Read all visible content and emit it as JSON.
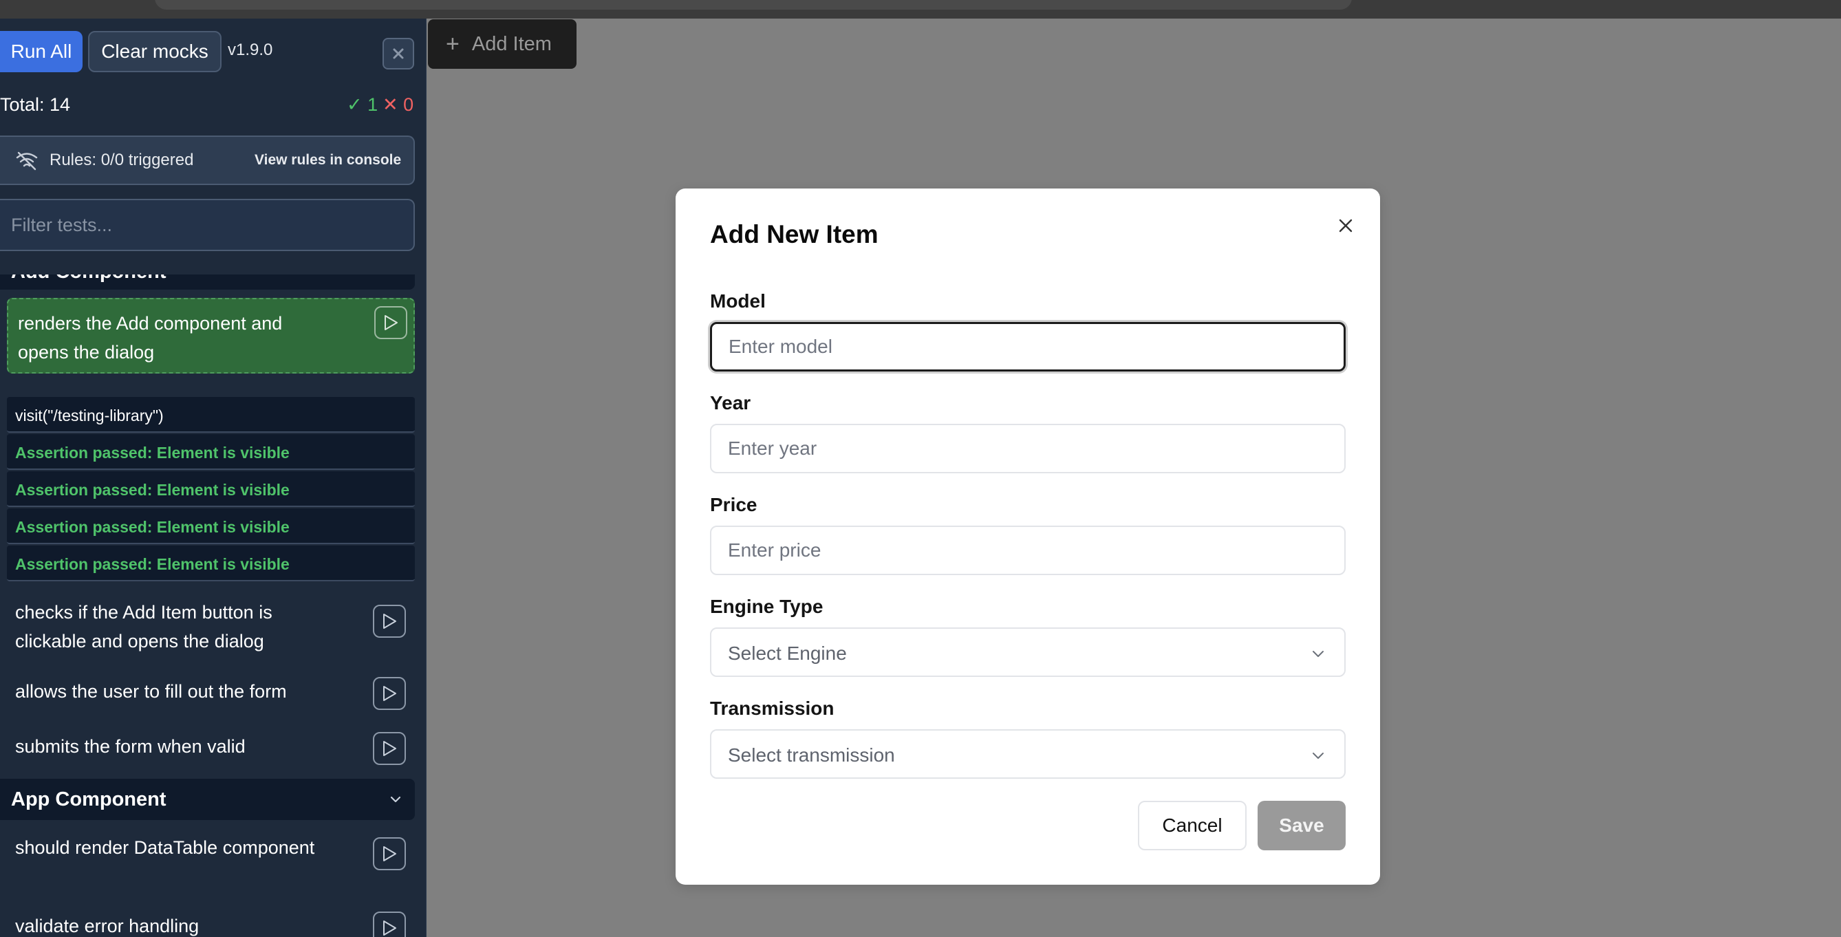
{
  "toolbar": {
    "run_all": "Run All",
    "clear_mocks": "Clear mocks",
    "version": "v1.9.0"
  },
  "totals": {
    "label": "Total: 14",
    "passed": "1",
    "failed": "0"
  },
  "rules": {
    "text": "Rules: 0/0 triggered",
    "link": "View rules in console"
  },
  "filter": {
    "placeholder": "Filter tests..."
  },
  "suites": {
    "add": {
      "name": "Add Component",
      "active_test": "renders the Add component and opens the dialog",
      "commands": [
        "visit(\"/testing-library\")",
        "Assertion passed: Element is visible",
        "Assertion passed: Element is visible",
        "Assertion passed: Element is visible",
        "Assertion passed: Element is visible"
      ],
      "tests": [
        "checks if the Add Item button is clickable and opens the dialog",
        "allows the user to fill out the form",
        "submits the form when valid"
      ]
    },
    "app": {
      "name": "App Component",
      "tests": [
        "should render DataTable component",
        "validate error handling"
      ]
    }
  },
  "add_button": {
    "label": "Add Item"
  },
  "modal": {
    "title": "Add New Item",
    "fields": {
      "model": {
        "label": "Model",
        "placeholder": "Enter model"
      },
      "year": {
        "label": "Year",
        "placeholder": "Enter year"
      },
      "price": {
        "label": "Price",
        "placeholder": "Enter price"
      },
      "engine": {
        "label": "Engine Type",
        "value": "Select Engine"
      },
      "transmission": {
        "label": "Transmission",
        "value": "Select transmission"
      }
    },
    "cancel": "Cancel",
    "save": "Save"
  },
  "colors": {
    "sidebar_bg": "#1e2a3b",
    "run_button": "#3b6fe0",
    "pass_green": "#4fc36a",
    "fail_red": "#f06262",
    "active_test_bg": "#2f6b3a",
    "overlay": "#808080"
  }
}
